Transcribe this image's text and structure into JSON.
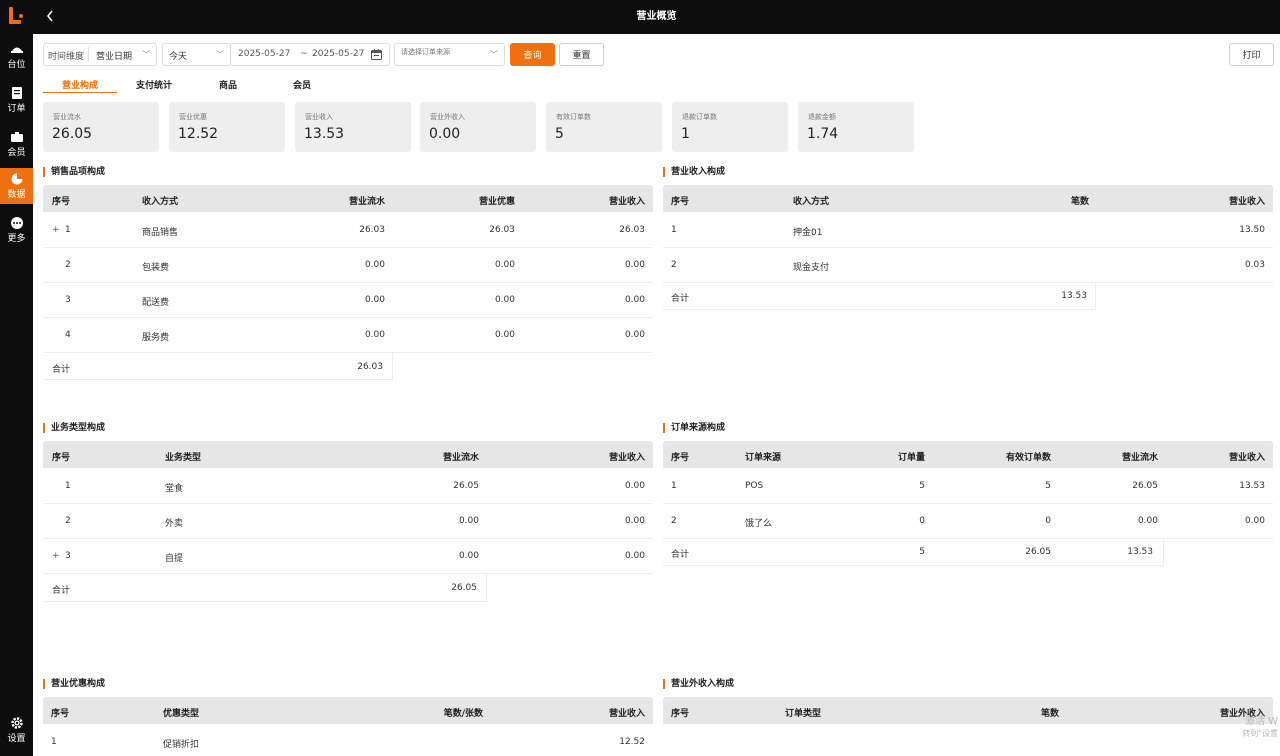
{
  "header": {
    "title": "营业概览"
  },
  "sidebar": {
    "items": [
      {
        "label": "台位",
        "icon": "table-icon"
      },
      {
        "label": "订单",
        "icon": "order-icon"
      },
      {
        "label": "会员",
        "icon": "member-icon"
      },
      {
        "label": "数据",
        "icon": "pie-chart-icon",
        "active": true
      },
      {
        "label": "更多",
        "icon": "more-icon"
      }
    ],
    "settings_label": "设置"
  },
  "filters": {
    "time_dim_label": "时间维度",
    "time_dim_value": "营业日期",
    "range_value": "今天",
    "date_start": "2025-05-27",
    "date_sep": "~",
    "date_end": "2025-05-27",
    "source_placeholder": "请选择订单来源",
    "query_label": "查询",
    "reset_label": "重置",
    "print_label": "打印"
  },
  "tabs": [
    {
      "label": "营业构成",
      "active": true
    },
    {
      "label": "支付统计"
    },
    {
      "label": "商品"
    },
    {
      "label": "会员"
    }
  ],
  "kpis": [
    {
      "label": "营业流水",
      "value": "26.05"
    },
    {
      "label": "营业优惠",
      "value": "12.52"
    },
    {
      "label": "营业收入",
      "value": "13.53"
    },
    {
      "label": "营业外收入",
      "value": "0.00"
    },
    {
      "label": "有效订单数",
      "value": "5"
    },
    {
      "label": "退款订单数",
      "value": "1"
    },
    {
      "label": "退款金额",
      "value": "1.74"
    }
  ],
  "sales": {
    "title": "销售品项构成",
    "headers": [
      "序号",
      "收入方式",
      "营业流水",
      "营业优惠",
      "营业收入"
    ],
    "rows": [
      [
        "1",
        "商品销售",
        "26.03",
        "26.03",
        "26.03"
      ],
      [
        "2",
        "包装费",
        "0.00",
        "0.00",
        "0.00"
      ],
      [
        "3",
        "配送费",
        "0.00",
        "0.00",
        "0.00"
      ],
      [
        "4",
        "服务费",
        "0.00",
        "0.00",
        "0.00"
      ]
    ],
    "total_label": "合计",
    "total_value": "26.03"
  },
  "income": {
    "title": "营业收入构成",
    "headers": [
      "序号",
      "收入方式",
      "笔数",
      "营业收入"
    ],
    "rows": [
      [
        "1",
        "押金01",
        "",
        "13.50"
      ],
      [
        "2",
        "现金支付",
        "",
        "0.03"
      ]
    ],
    "total_label": "合计",
    "total_value": "13.53"
  },
  "business": {
    "title": "业务类型构成",
    "headers": [
      "序号",
      "业务类型",
      "营业流水",
      "营业收入"
    ],
    "rows": [
      [
        "1",
        "堂食",
        "26.05",
        "0.00"
      ],
      [
        "2",
        "外卖",
        "0.00",
        "0.00"
      ],
      [
        "3",
        "自提",
        "0.00",
        "0.00"
      ]
    ],
    "total_label": "合计",
    "total_value": "26.05"
  },
  "source": {
    "title": "订单来源构成",
    "headers": [
      "序号",
      "订单来源",
      "订单量",
      "有效订单数",
      "营业流水",
      "营业收入"
    ],
    "rows": [
      [
        "1",
        "POS",
        "5",
        "5",
        "26.05",
        "13.53"
      ],
      [
        "2",
        "饿了么",
        "0",
        "0",
        "0.00",
        "0.00"
      ]
    ],
    "total_label": "合计",
    "total_values": [
      "5",
      "26.05",
      "13.53"
    ]
  },
  "discount": {
    "title": "营业优惠构成",
    "headers": [
      "序号",
      "优惠类型",
      "笔数/张数",
      "营业收入"
    ],
    "rows": [
      [
        "1",
        "促销折扣",
        "",
        "12.52"
      ]
    ]
  },
  "other_income": {
    "title": "营业外收入构成",
    "headers": [
      "序号",
      "订单类型",
      "笔数",
      "营业外收入"
    ]
  },
  "watermark": {
    "line1": "激活 W",
    "line2": "转到\"设置"
  }
}
